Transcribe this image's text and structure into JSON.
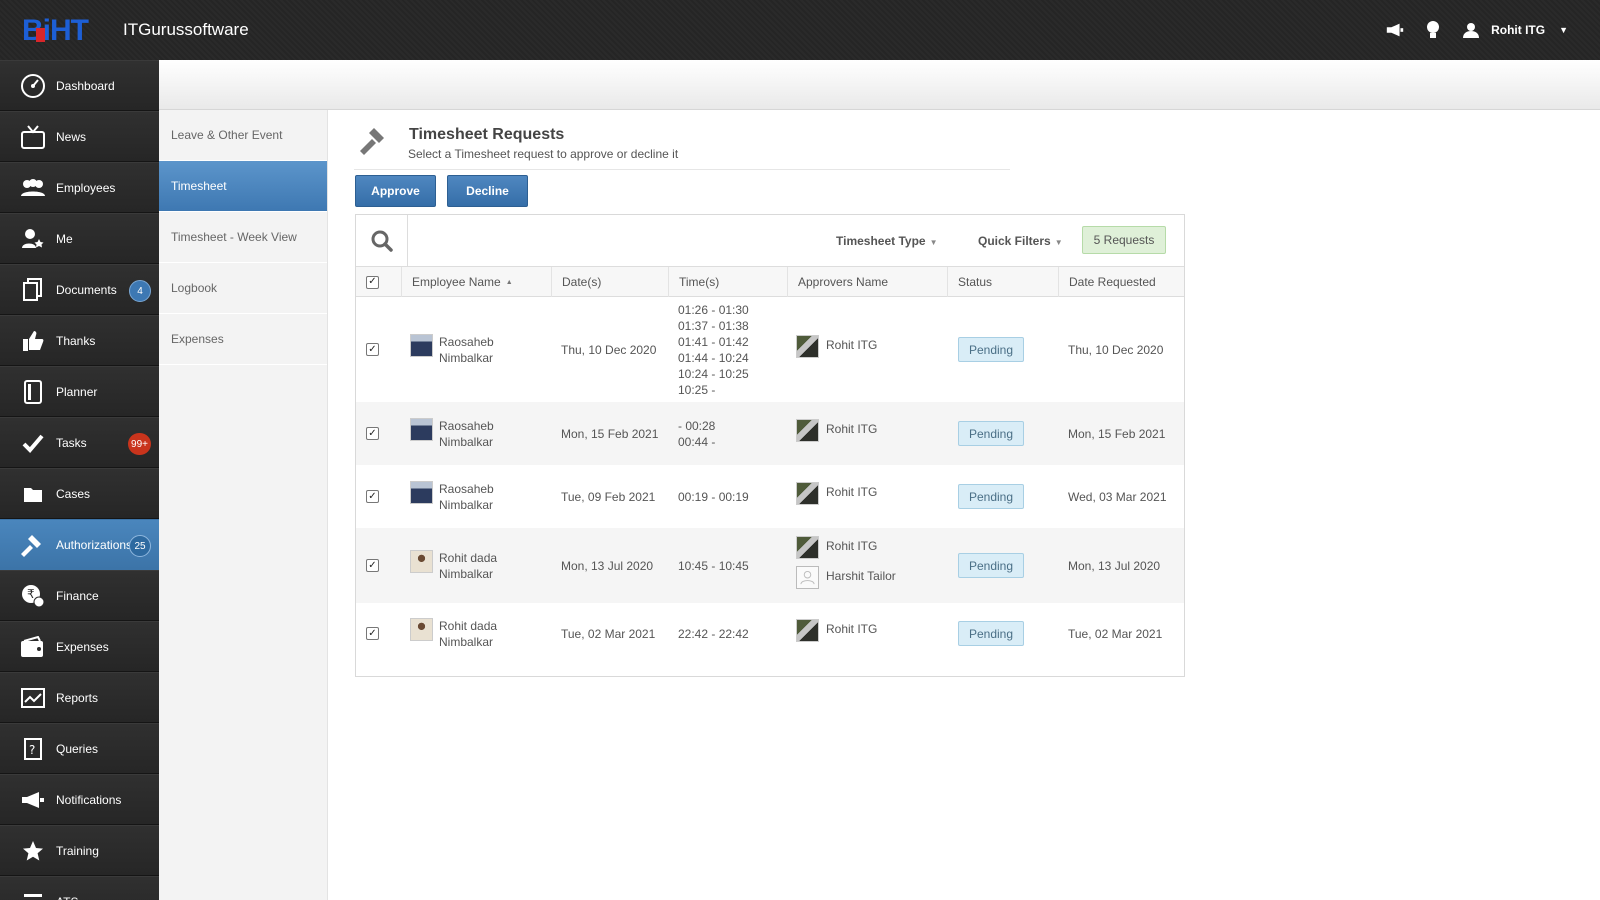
{
  "app": {
    "brand": "ITGurussoftware",
    "logo_text": "BiHT"
  },
  "topbar": {
    "user_name": "Rohit ITG"
  },
  "sidebar": {
    "items": [
      {
        "label": "Dashboard",
        "icon": "dashboard-icon",
        "badge": ""
      },
      {
        "label": "News",
        "icon": "tv-icon",
        "badge": ""
      },
      {
        "label": "Employees",
        "icon": "people-icon",
        "badge": ""
      },
      {
        "label": "Me",
        "icon": "user-star-icon",
        "badge": ""
      },
      {
        "label": "Documents",
        "icon": "documents-icon",
        "badge": "4"
      },
      {
        "label": "Thanks",
        "icon": "thumbs-up-icon",
        "badge": ""
      },
      {
        "label": "Planner",
        "icon": "planner-icon",
        "badge": ""
      },
      {
        "label": "Tasks",
        "icon": "check-icon",
        "badge": "99+"
      },
      {
        "label": "Cases",
        "icon": "folder-icon",
        "badge": ""
      },
      {
        "label": "Authorizations",
        "icon": "gavel-icon",
        "badge": "25"
      },
      {
        "label": "Finance",
        "icon": "rupee-icon",
        "badge": ""
      },
      {
        "label": "Expenses",
        "icon": "wallet-icon",
        "badge": ""
      },
      {
        "label": "Reports",
        "icon": "chart-icon",
        "badge": ""
      },
      {
        "label": "Queries",
        "icon": "question-doc-icon",
        "badge": ""
      },
      {
        "label": "Notifications",
        "icon": "megaphone-icon",
        "badge": ""
      },
      {
        "label": "Training",
        "icon": "star-icon",
        "badge": ""
      },
      {
        "label": "ATS",
        "icon": "ats-icon",
        "badge": ""
      }
    ],
    "active_index": 9
  },
  "subnav": {
    "items": [
      "Leave & Other Event",
      "Timesheet",
      "Timesheet - Week View",
      "Logbook",
      "Expenses"
    ],
    "active_index": 1
  },
  "page": {
    "title": "Timesheet Requests",
    "subtitle": "Select a Timesheet request to approve or decline it",
    "approve_label": "Approve",
    "decline_label": "Decline"
  },
  "filters": {
    "timesheet_type": "Timesheet Type",
    "quick_filters": "Quick Filters",
    "requests_count": "5 Requests"
  },
  "table": {
    "columns": [
      "Employee Name",
      "Date(s)",
      "Time(s)",
      "Approvers Name",
      "Status",
      "Date Requested"
    ],
    "rows": [
      {
        "employee": [
          "Raosaheb",
          "Nimbalkar"
        ],
        "avatar": "suit",
        "date": "Thu, 10 Dec 2020",
        "times": [
          "01:26 - 01:30",
          "01:37 - 01:38",
          "01:41 - 01:42",
          "01:44 - 10:24",
          "10:24 - 10:25",
          "10:25 -"
        ],
        "approvers": [
          "Rohit ITG"
        ],
        "status": "Pending",
        "requested": "Thu, 10 Dec 2020"
      },
      {
        "employee": [
          "Raosaheb",
          "Nimbalkar"
        ],
        "avatar": "suit",
        "date": "Mon, 15 Feb 2021",
        "times": [
          "- 00:28",
          "00:44 -"
        ],
        "approvers": [
          "Rohit ITG"
        ],
        "status": "Pending",
        "requested": "Mon, 15 Feb 2021"
      },
      {
        "employee": [
          "Raosaheb",
          "Nimbalkar"
        ],
        "avatar": "suit",
        "date": "Tue, 09 Feb 2021",
        "times": [
          "00:19 - 00:19"
        ],
        "approvers": [
          "Rohit ITG"
        ],
        "status": "Pending",
        "requested": "Wed, 03 Mar 2021"
      },
      {
        "employee": [
          "Rohit dada",
          "Nimbalkar"
        ],
        "avatar": "face",
        "date": "Mon, 13 Jul 2020",
        "times": [
          "10:45 - 10:45"
        ],
        "approvers": [
          "Rohit ITG",
          "Harshit Tailor"
        ],
        "status": "Pending",
        "requested": "Mon, 13 Jul 2020"
      },
      {
        "employee": [
          "Rohit dada",
          "Nimbalkar"
        ],
        "avatar": "face",
        "date": "Tue, 02 Mar 2021",
        "times": [
          "22:42 - 22:42"
        ],
        "approvers": [
          "Rohit ITG"
        ],
        "status": "Pending",
        "requested": "Tue, 02 Mar 2021"
      }
    ]
  },
  "colors": {
    "accent": "#3e78b2",
    "sidebar": "#2b2b2b",
    "pending_bg": "#d9edf7",
    "requests_bg": "#dff0d8"
  }
}
